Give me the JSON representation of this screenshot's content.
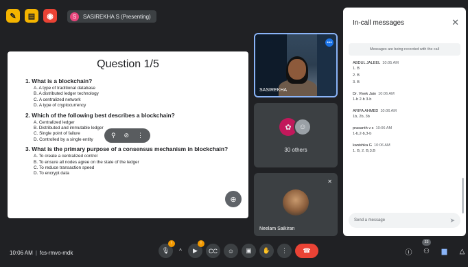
{
  "top": {
    "presenter_avatar": "S",
    "presenting_label": "SASIREKHA S (Presenting)"
  },
  "slide": {
    "title": "Question 1/5",
    "questions": [
      {
        "q": "1. What is a blockchain?",
        "opts": [
          "A. A type of traditional database",
          "B. A distributed ledger technology",
          "C. A centralized network",
          "D. A type of cryptocurrency"
        ]
      },
      {
        "q": "2. Which of the following best describes a blockchain?",
        "opts": [
          "A. Centralized ledger",
          "B. Distributed and immutable ledger",
          "C. Single point of failure",
          "D. Controlled by a single entity"
        ]
      },
      {
        "q": "3. What is the primary purpose of a consensus mechanism in blockchain?",
        "opts": [
          "A. To create a centralized control",
          "B. To ensure all nodes agree on the state of the ledger",
          "C. To reduce transaction speed",
          "D. To encrypt data"
        ]
      }
    ]
  },
  "tiles": {
    "presenter_name": "SASIREKHA",
    "others_label": "30 others",
    "participant_name": "Neelam Saikiran"
  },
  "chat": {
    "title": "In-call messages",
    "note": "Messages are being recorded with the call",
    "messages": [
      {
        "who": "ABDUL JALEEL",
        "time": "10:05 AM",
        "lines": [
          "1.   B",
          "2.   B",
          "3.   B"
        ]
      },
      {
        "who": "Dr. Vivek Jain",
        "time": "10:06 AM",
        "lines": [
          "1-b 2-b 3-b"
        ]
      },
      {
        "who": "ARIFA AHMED",
        "time": "10:06 AM",
        "lines": [
          "1b, 2b, 3b"
        ]
      },
      {
        "who": "prasanth v s",
        "time": "10:06 AM",
        "lines": [
          "1-b,2-b,3-b"
        ]
      },
      {
        "who": "kanishka G",
        "time": "10:06 AM",
        "lines": [
          "1. B, 2. B,3.B"
        ]
      }
    ],
    "input_placeholder": "Send a message"
  },
  "bottom": {
    "time": "10:06 AM",
    "meeting_code": "fcs-rmvo-mdk",
    "participant_count": "33"
  },
  "icons": {
    "mic": "mic-off-icon",
    "camera": "camera-off-icon",
    "captions": "captions-icon",
    "emoji": "emoji-icon",
    "present": "present-icon",
    "hand": "raise-hand-icon",
    "more": "more-vert-icon",
    "end": "end-call-icon"
  },
  "colors": {
    "accent": "#8ab4f8",
    "end_call": "#ea4335",
    "badge": "#f29900"
  }
}
